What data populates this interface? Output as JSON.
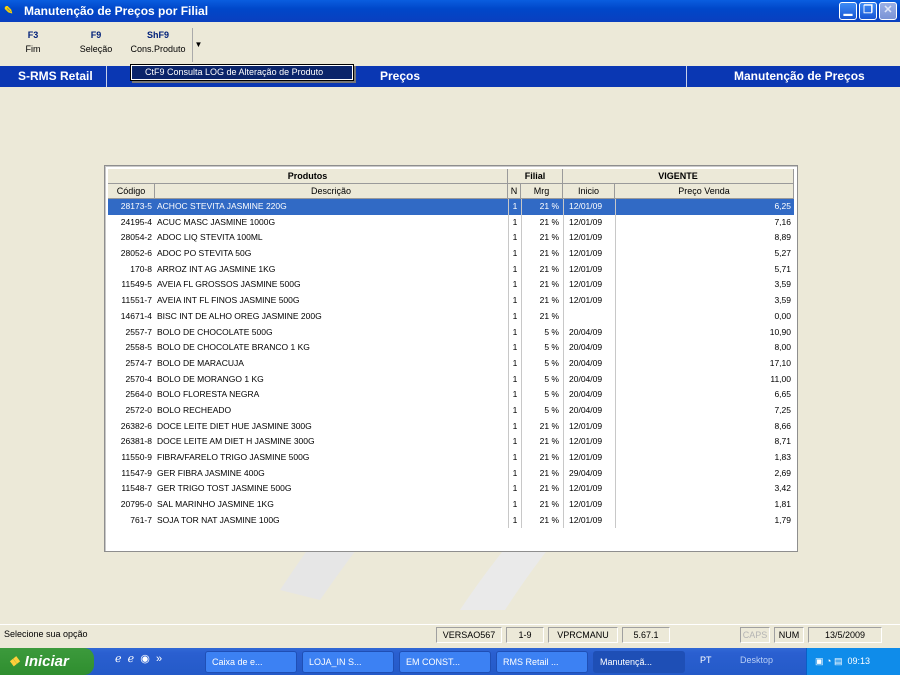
{
  "window": {
    "title": "Manutenção de Preços por Filial"
  },
  "toolbar": {
    "buttons": [
      {
        "key": "F3",
        "label": "Fim"
      },
      {
        "key": "F9",
        "label": "Seleção"
      },
      {
        "key": "ShF9",
        "label": "Cons.Produto"
      }
    ]
  },
  "dropdown_menu": {
    "item": "CtF9  Consulta LOG de Alteração de Produto"
  },
  "header_bar": {
    "left": "S-RMS Retail",
    "center": "Preços",
    "right": "Manutenção de Preços"
  },
  "table": {
    "group_headers": [
      "Produtos",
      "Filial",
      "VIGENTE"
    ],
    "columns": [
      "Código",
      "Descrição",
      "N",
      "Mrg",
      "Inicio",
      "Preço Venda"
    ],
    "rows": [
      {
        "codigo": "28173-5",
        "descricao": "ACHOC STEVITA JASMINE 220G",
        "n": "1",
        "mrg": "21 %",
        "inicio": "12/01/09",
        "preco": "6,25"
      },
      {
        "codigo": "24195-4",
        "descricao": "ACUC MASC JASMINE 1000G",
        "n": "1",
        "mrg": "21 %",
        "inicio": "12/01/09",
        "preco": "7,16"
      },
      {
        "codigo": "28054-2",
        "descricao": "ADOC LIQ STEVITA 100ML",
        "n": "1",
        "mrg": "21 %",
        "inicio": "12/01/09",
        "preco": "8,89"
      },
      {
        "codigo": "28052-6",
        "descricao": "ADOC PO STEVITA 50G",
        "n": "1",
        "mrg": "21 %",
        "inicio": "12/01/09",
        "preco": "5,27"
      },
      {
        "codigo": "170-8",
        "descricao": "ARROZ INT AG JASMINE 1KG",
        "n": "1",
        "mrg": "21 %",
        "inicio": "12/01/09",
        "preco": "5,71"
      },
      {
        "codigo": "11549-5",
        "descricao": "AVEIA FL GROSSOS JASMINE 500G",
        "n": "1",
        "mrg": "21 %",
        "inicio": "12/01/09",
        "preco": "3,59"
      },
      {
        "codigo": "11551-7",
        "descricao": "AVEIA INT FL FINOS JASMINE 500G",
        "n": "1",
        "mrg": "21 %",
        "inicio": "12/01/09",
        "preco": "3,59"
      },
      {
        "codigo": "14671-4",
        "descricao": "BISC INT DE ALHO OREG JASMINE 200G",
        "n": "1",
        "mrg": "21 %",
        "inicio": "",
        "preco": "0,00"
      },
      {
        "codigo": "2557-7",
        "descricao": "BOLO DE CHOCOLATE 500G",
        "n": "1",
        "mrg": "5 %",
        "inicio": "20/04/09",
        "preco": "10,90"
      },
      {
        "codigo": "2558-5",
        "descricao": "BOLO DE CHOCOLATE BRANCO 1 KG",
        "n": "1",
        "mrg": "5 %",
        "inicio": "20/04/09",
        "preco": "8,00"
      },
      {
        "codigo": "2574-7",
        "descricao": "BOLO DE MARACUJA",
        "n": "1",
        "mrg": "5 %",
        "inicio": "20/04/09",
        "preco": "17,10"
      },
      {
        "codigo": "2570-4",
        "descricao": "BOLO DE MORANGO 1 KG",
        "n": "1",
        "mrg": "5 %",
        "inicio": "20/04/09",
        "preco": "11,00"
      },
      {
        "codigo": "2564-0",
        "descricao": "BOLO FLORESTA NEGRA",
        "n": "1",
        "mrg": "5 %",
        "inicio": "20/04/09",
        "preco": "6,65"
      },
      {
        "codigo": "2572-0",
        "descricao": "BOLO RECHEADO",
        "n": "1",
        "mrg": "5 %",
        "inicio": "20/04/09",
        "preco": "7,25"
      },
      {
        "codigo": "26382-6",
        "descricao": "DOCE  LEITE DIET HUE JASMINE 300G",
        "n": "1",
        "mrg": "21 %",
        "inicio": "12/01/09",
        "preco": "8,66"
      },
      {
        "codigo": "26381-8",
        "descricao": "DOCE LEITE AM DIET H JASMINE 300G",
        "n": "1",
        "mrg": "21 %",
        "inicio": "12/01/09",
        "preco": "8,71"
      },
      {
        "codigo": "11550-9",
        "descricao": "FIBRA/FARELO TRIGO JASMINE 500G",
        "n": "1",
        "mrg": "21 %",
        "inicio": "12/01/09",
        "preco": "1,83"
      },
      {
        "codigo": "11547-9",
        "descricao": "GER FIBRA JASMINE 400G",
        "n": "1",
        "mrg": "21 %",
        "inicio": "29/04/09",
        "preco": "2,69"
      },
      {
        "codigo": "11548-7",
        "descricao": "GER TRIGO TOST JASMINE 500G",
        "n": "1",
        "mrg": "21 %",
        "inicio": "12/01/09",
        "preco": "3,42"
      },
      {
        "codigo": "20795-0",
        "descricao": "SAL MARINHO JASMINE 1KG",
        "n": "1",
        "mrg": "21 %",
        "inicio": "12/01/09",
        "preco": "1,81"
      },
      {
        "codigo": "761-7",
        "descricao": "SOJA TOR NAT JASMINE 100G",
        "n": "1",
        "mrg": "21 %",
        "inicio": "12/01/09",
        "preco": "1,79"
      }
    ]
  },
  "statusbar": {
    "message": "Selecione sua opção",
    "version": "VERSAO567",
    "range": "1-9",
    "program": "VPRCMANU",
    "build": "5.67.1",
    "caps": "CAPS",
    "num": "NUM",
    "date": "13/5/2009"
  },
  "taskbar": {
    "start": "Iniciar",
    "tasks": [
      "Caixa de e...",
      "LOJA_IN S...",
      "EM CONST...",
      "RMS Retail ...",
      "Manutençã..."
    ],
    "lang": "PT",
    "desktop": "Desktop",
    "clock": "09:13"
  },
  "colors": {
    "title": "#0047c9",
    "header_bar": "#0a37b3",
    "selection": "#316ac5"
  }
}
